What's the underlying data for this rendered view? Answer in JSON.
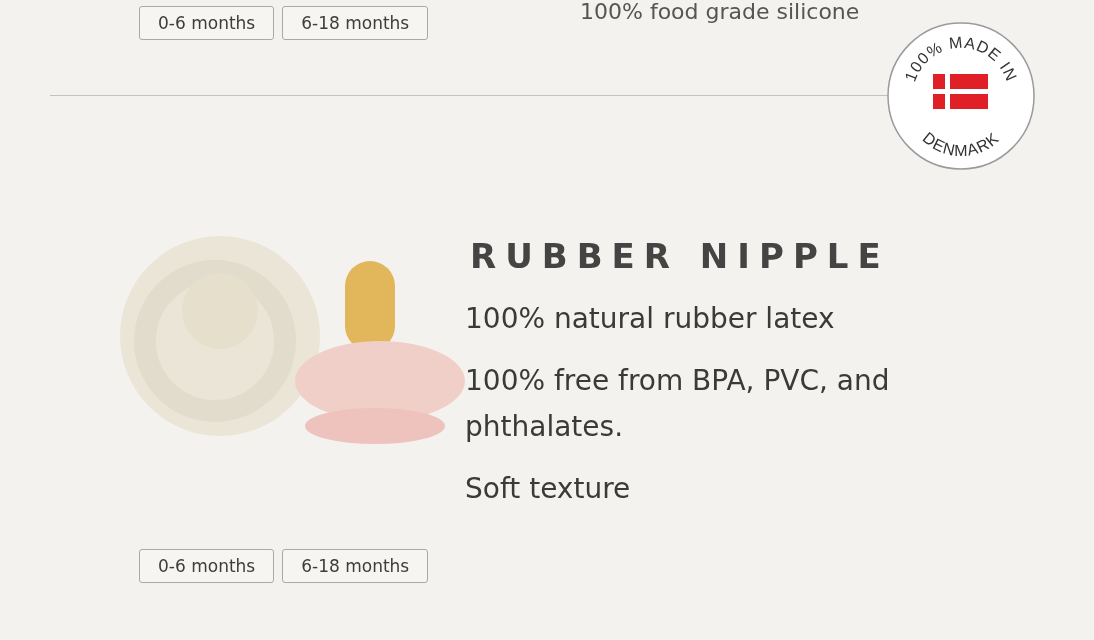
{
  "top_section": {
    "age_tags": [
      "0-6 months",
      "6-18 months"
    ],
    "feature_cut": "100% food grade silicone"
  },
  "badge": {
    "top_text": "100% MADE IN",
    "bottom_text": "DENMARK"
  },
  "product": {
    "age_tags": [
      "0-6 months",
      "6-18 months"
    ],
    "heading": "RUBBER NIPPLE",
    "features": [
      "100% natural rubber latex",
      "100% free from BPA, PVC, and phthalates.",
      "Soft texture"
    ]
  }
}
